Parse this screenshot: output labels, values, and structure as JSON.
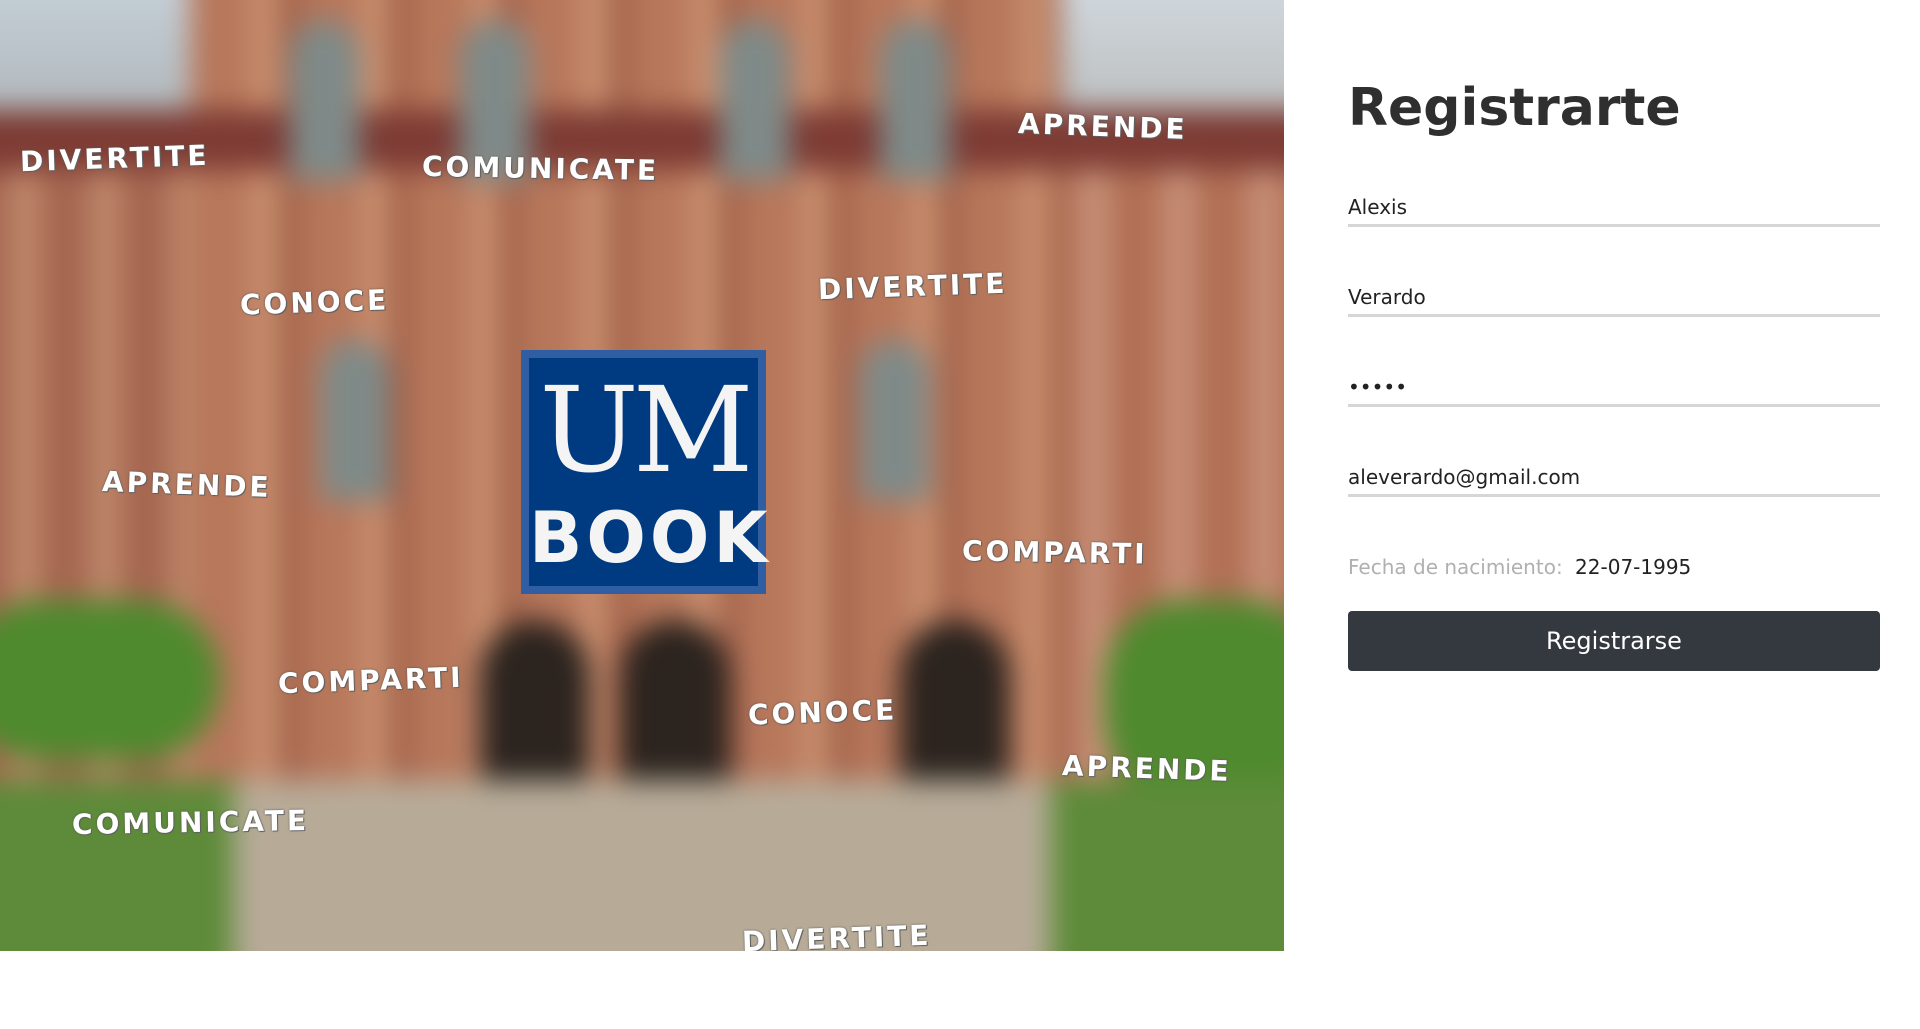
{
  "hero": {
    "logo": {
      "line1": "UM",
      "line2": "BOOK",
      "color": "#003a80"
    },
    "floating_words": [
      "DIVERTITE",
      "COMUNICATE",
      "APRENDE",
      "CONOCE",
      "DIVERTITE",
      "APRENDE",
      "COMPARTI",
      "COMPARTI",
      "CONOCE",
      "APRENDE",
      "COMUNICATE",
      "DIVERTITE"
    ]
  },
  "form": {
    "title": "Registrarte",
    "first_name": "Alexis",
    "last_name": "Verardo",
    "password": "aaaaa",
    "email": "aleverardo@gmail.com",
    "birth_label": "Fecha de nacimiento:",
    "birth_value": "22-07-1995",
    "submit_label": "Registrarse",
    "submit_color": "#34393f"
  }
}
